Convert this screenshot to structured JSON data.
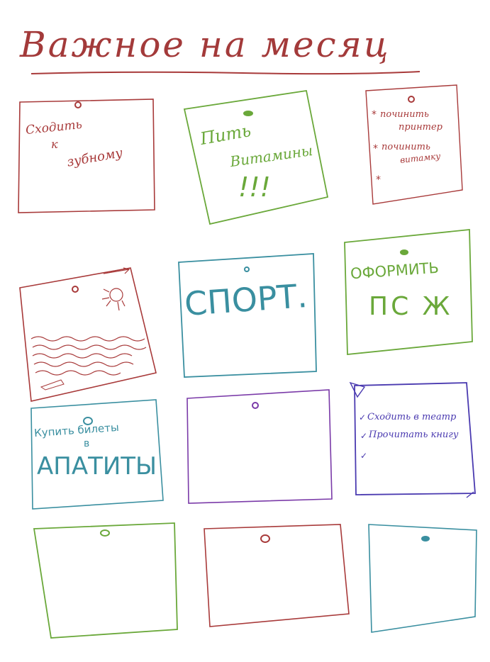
{
  "title": "Важное на месяц",
  "colors": {
    "red": "#a83a3a",
    "green": "#6aa83a",
    "teal": "#3a8fa0",
    "purple": "#7a3aa8",
    "indigo": "#4a3ab0"
  },
  "notes": {
    "dentist": {
      "line1": "Сходить",
      "line2": "к",
      "line3": "зубному"
    },
    "vitamins": {
      "line1": "Пить",
      "line2": "Витамины",
      "line3": "!!!"
    },
    "fix": {
      "item1": "починить",
      "item1b": "принтер",
      "item2": "починить",
      "item2b": "витамку",
      "bullet": "*"
    },
    "sport": {
      "text": "СПОРТ."
    },
    "docs": {
      "line1": "ОФОРМИТЬ",
      "line2": "ПС Ж"
    },
    "tickets": {
      "line1": "Купить билеты",
      "line2": "в",
      "line3": "АПАТИТЫ"
    },
    "todo": {
      "item1": "Сходить в театр",
      "item2": "Прочитать книгу",
      "check": "✓"
    }
  }
}
